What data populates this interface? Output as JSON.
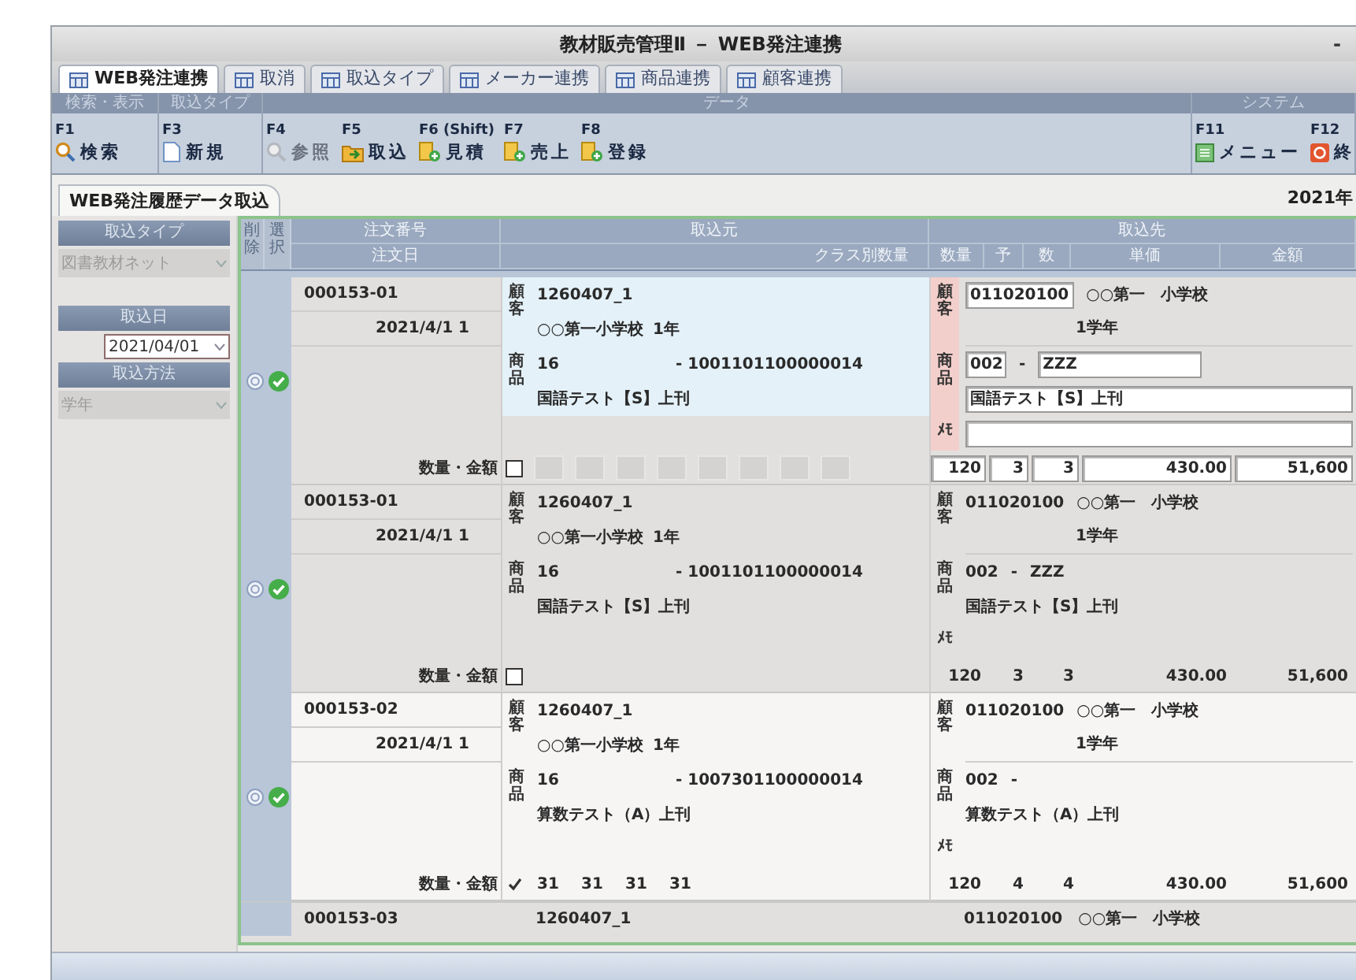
{
  "window": {
    "title": "教材販売管理Ⅱ － WEB発注連携",
    "minimize": "-"
  },
  "tabs": [
    {
      "label": "WEB発注連携",
      "selected": true
    },
    {
      "label": "取消",
      "selected": false
    },
    {
      "label": "取込タイプ",
      "selected": false
    },
    {
      "label": "メーカー連携",
      "selected": false
    },
    {
      "label": "商品連携",
      "selected": false
    },
    {
      "label": "顧客連携",
      "selected": false
    }
  ],
  "toolbar": {
    "groups": [
      {
        "label": "検索・表示",
        "buttons": [
          {
            "key": "F1",
            "label": "検索",
            "kind": "search",
            "disabled": false
          }
        ]
      },
      {
        "label": "取込タイプ",
        "buttons": [
          {
            "key": "F3",
            "label": "新規",
            "kind": "new",
            "disabled": false
          }
        ]
      },
      {
        "label": "データ",
        "buttons": [
          {
            "key": "F4",
            "label": "参照",
            "kind": "view",
            "disabled": true
          },
          {
            "key": "F5",
            "label": "取込",
            "kind": "import",
            "disabled": false
          },
          {
            "key": "F6 (Shift)",
            "label": "見積",
            "kind": "doc",
            "disabled": false
          },
          {
            "key": "F7",
            "label": "売上",
            "kind": "doc",
            "disabled": false
          },
          {
            "key": "F8",
            "label": "登録",
            "kind": "doc",
            "disabled": false
          }
        ]
      },
      {
        "label": "システム",
        "buttons": [
          {
            "key": "F11",
            "label": "メニュー",
            "kind": "menu",
            "disabled": false
          },
          {
            "key": "F12",
            "label": "終",
            "kind": "exit",
            "disabled": false
          }
        ]
      }
    ]
  },
  "subtab": {
    "label": "WEB発注履歴データ取込",
    "date": "2021年"
  },
  "filters": [
    {
      "label": "取込タイプ",
      "value": "図書教材ネット",
      "kind": "select",
      "disabled": true
    },
    {
      "label": "取込日",
      "value": "2021/04/01",
      "kind": "date",
      "disabled": false
    },
    {
      "label": "取込方法",
      "value": "学年",
      "kind": "select",
      "disabled": true
    }
  ],
  "grid": {
    "headers": {
      "delete": "削除",
      "select": "選択",
      "order_no": "注文番号",
      "order_date": "注文日",
      "source": "取込元",
      "source_sub": "クラス別数量",
      "dest": "取込先",
      "qty": "数量",
      "yo": "予",
      "kazu": "数",
      "price": "単価",
      "amount": "金額"
    },
    "rows": [
      {
        "kind": "full",
        "editing": true,
        "shaded": true,
        "checked": true,
        "order_no": "000153-01",
        "order_date": "2021/4/1 1",
        "src_labels": [
          "顧客",
          "商品"
        ],
        "src_code": "1260407_1",
        "src_school": "○○第一小学校",
        "src_grade": "1年",
        "src_product_code": "16",
        "src_product_no": "- 1001101100000014",
        "src_product_name": "国語テスト【S】上刊",
        "qty_label": "数量・金額",
        "class_checked": false,
        "class_qty": [
          {
            "kind": "empty"
          },
          {
            "kind": "empty"
          },
          {
            "kind": "empty"
          },
          {
            "kind": "empty"
          },
          {
            "kind": "empty"
          },
          {
            "kind": "empty"
          },
          {
            "kind": "empty"
          },
          {
            "kind": "empty"
          }
        ],
        "dest_labels": [
          "顧客",
          "商品",
          "ﾒﾓ"
        ],
        "dest_code": "011020100",
        "dest_school": "○○第一　小学校",
        "dest_grade": "1学年",
        "dest_product_code": "002",
        "dest_product_sep": "-",
        "dest_product_sub": "ZZZ",
        "dest_product_name": "国語テスト【S】上刊",
        "qty": "120",
        "yo": "3",
        "kazu": "3",
        "price": "430.00",
        "amount": "51,600"
      },
      {
        "kind": "full",
        "editing": false,
        "shaded": true,
        "checked": true,
        "order_no": "000153-01",
        "order_date": "2021/4/1 1",
        "src_labels": [
          "顧客",
          "商品"
        ],
        "src_code": "1260407_1",
        "src_school": "○○第一小学校",
        "src_grade": "1年",
        "src_product_code": "16",
        "src_product_no": "- 1001101100000014",
        "src_product_name": "国語テスト【S】上刊",
        "qty_label": "数量・金額",
        "class_checked": false,
        "class_qty": [],
        "dest_labels": [
          "顧客",
          "商品",
          "ﾒﾓ"
        ],
        "dest_code": "011020100",
        "dest_school": "○○第一　小学校",
        "dest_grade": "1学年",
        "dest_product_code": "002",
        "dest_product_sep": "-",
        "dest_product_sub": "ZZZ",
        "dest_product_name": "国語テスト【S】上刊",
        "qty": "120",
        "yo": "3",
        "kazu": "3",
        "price": "430.00",
        "amount": "51,600"
      },
      {
        "kind": "full",
        "editing": false,
        "shaded": false,
        "checked": true,
        "order_no": "000153-02",
        "order_date": "2021/4/1 1",
        "src_labels": [
          "顧客",
          "商品"
        ],
        "src_code": "1260407_1",
        "src_school": "○○第一小学校",
        "src_grade": "1年",
        "src_product_code": "16",
        "src_product_no": "- 1007301100000014",
        "src_product_name": "算数テスト（A）上刊",
        "qty_label": "数量・金額",
        "class_checked": true,
        "class_qty": [
          {
            "kind": "value",
            "value": "31"
          },
          {
            "kind": "value",
            "value": "31"
          },
          {
            "kind": "value",
            "value": "31"
          },
          {
            "kind": "value",
            "value": "31"
          }
        ],
        "dest_labels": [
          "顧客",
          "商品",
          "ﾒﾓ"
        ],
        "dest_code": "011020100",
        "dest_school": "○○第一　小学校",
        "dest_grade": "1学年",
        "dest_product_code": "002",
        "dest_product_sep": "-",
        "dest_product_name": "算数テスト（A）上刊",
        "qty": "120",
        "yo": "4",
        "kazu": "4",
        "price": "430.00",
        "amount": "51,600"
      },
      {
        "kind": "partial",
        "shaded": true,
        "order_no": "000153-03",
        "src_code": "1260407_1",
        "dest_code": "011020100",
        "dest_school": "○○第一　小学校"
      }
    ]
  }
}
